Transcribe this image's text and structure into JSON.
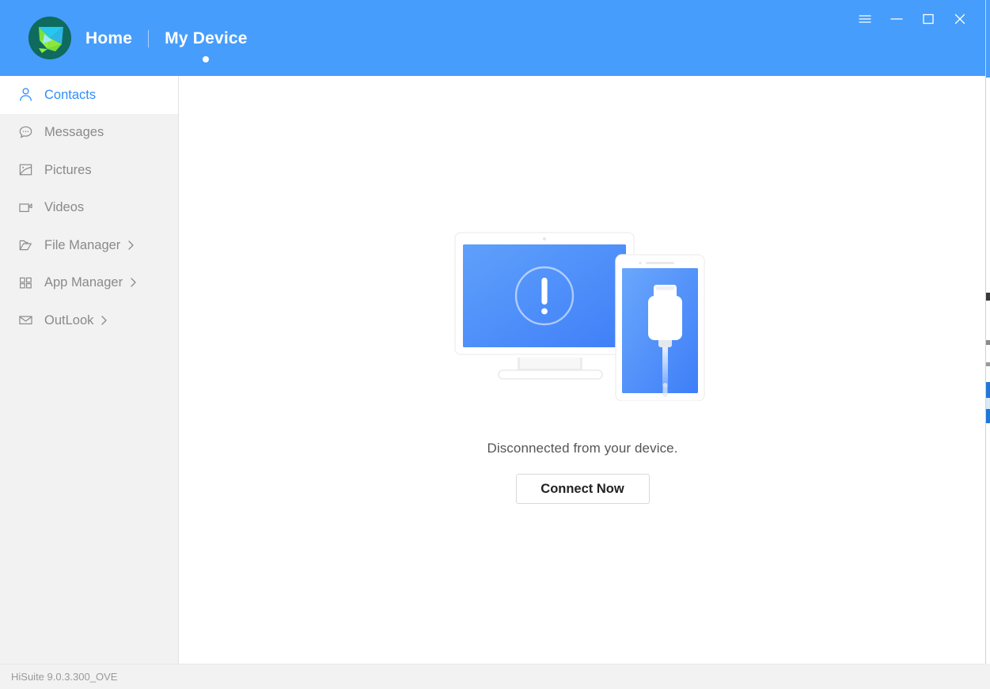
{
  "window": {
    "titlebar": {
      "logo_icon": "hisuite-logo-icon",
      "nav": [
        {
          "label": "Home",
          "active": false,
          "has_dot": false
        },
        {
          "label": "My Device",
          "active": true,
          "has_dot": true
        }
      ],
      "controls": [
        {
          "name": "menu-button",
          "icon": "hamburger-icon"
        },
        {
          "name": "minimize-button",
          "icon": "minimize-icon"
        },
        {
          "name": "maximize-button",
          "icon": "maximize-icon"
        },
        {
          "name": "close-button",
          "icon": "close-icon"
        }
      ]
    },
    "accent_color": "#469dfc",
    "sidebar_bg": "#f2f2f2",
    "selected_text_color": "#2f8dfa"
  },
  "sidebar": {
    "items": [
      {
        "label": "Contacts",
        "icon": "person-icon",
        "active": true,
        "chevron": false
      },
      {
        "label": "Messages",
        "icon": "chat-bubble-icon",
        "active": false,
        "chevron": false
      },
      {
        "label": "Pictures",
        "icon": "image-icon",
        "active": false,
        "chevron": false
      },
      {
        "label": "Videos",
        "icon": "video-camera-icon",
        "active": false,
        "chevron": false
      },
      {
        "label": "File Manager",
        "icon": "folder-icon",
        "active": false,
        "chevron": true
      },
      {
        "label": "App Manager",
        "icon": "grid-apps-icon",
        "active": false,
        "chevron": true
      },
      {
        "label": "OutLook",
        "icon": "envelope-icon",
        "active": false,
        "chevron": true
      }
    ]
  },
  "main": {
    "illustration": {
      "name": "disconnected-device-illustration",
      "monitor_icon": "monitor-with-warning-icon",
      "warning_icon": "exclamation-circle-icon",
      "phone_icon": "phone-with-usb-cable-icon",
      "cable_icon": "usb-connector-icon"
    },
    "status_text": "Disconnected from your device.",
    "connect_button": "Connect Now"
  },
  "footer": {
    "version": "HiSuite 9.0.3.300_OVE"
  }
}
